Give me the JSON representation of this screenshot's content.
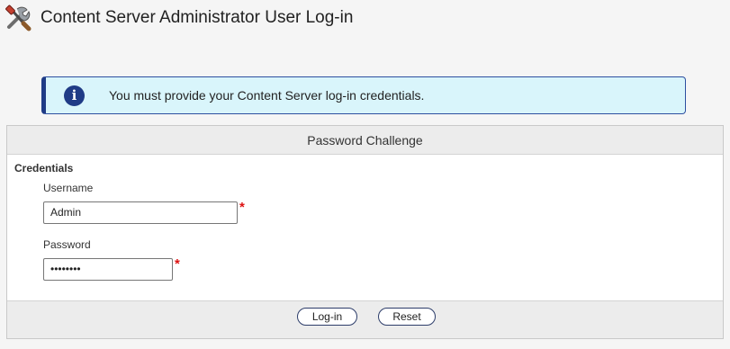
{
  "header": {
    "title": "Content Server Administrator User Log-in",
    "icon": "tools-icon"
  },
  "alert": {
    "icon": "info-icon",
    "glyph": "i",
    "message": "You must provide your Content Server log-in credentials."
  },
  "panel": {
    "title": "Password Challenge",
    "section_title": "Credentials",
    "username": {
      "label": "Username",
      "value": "Admin",
      "required_mark": "*"
    },
    "password": {
      "label": "Password",
      "value": "••••••••",
      "required_mark": "*"
    }
  },
  "buttons": {
    "login": "Log-in",
    "reset": "Reset"
  },
  "colors": {
    "accent": "#1f3b86",
    "alert_bg": "#d9f5fb",
    "required": "#dd1111"
  }
}
